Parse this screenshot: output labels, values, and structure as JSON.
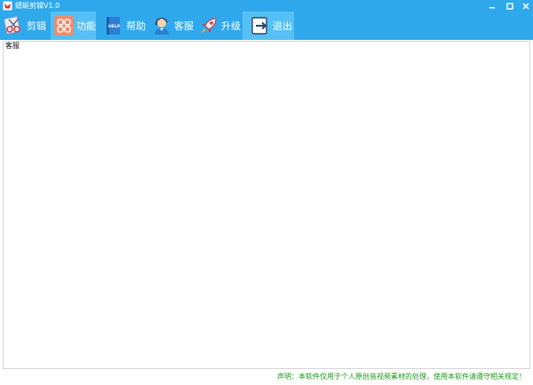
{
  "window": {
    "title": "蜻蜓剪辑V1.0"
  },
  "toolbar": {
    "items": [
      {
        "label": "剪辑",
        "icon": "scissors-icon"
      },
      {
        "label": "功能",
        "icon": "apps-grid-icon"
      },
      {
        "label": "帮助",
        "icon": "help-book-icon"
      },
      {
        "label": "客服",
        "icon": "customer-service-icon"
      },
      {
        "label": "升级",
        "icon": "rocket-icon"
      },
      {
        "label": "退出",
        "icon": "exit-icon"
      }
    ]
  },
  "main": {
    "group_label": "客服"
  },
  "footer": {
    "statement": "声明：本软件仅用于个人原创音视频素材的处理，使用本软件请遵守相关规定！"
  },
  "colors": {
    "accent": "#2fa9ec",
    "active_tab": "#56c0f4",
    "statement_text": "#1a9a1a"
  }
}
